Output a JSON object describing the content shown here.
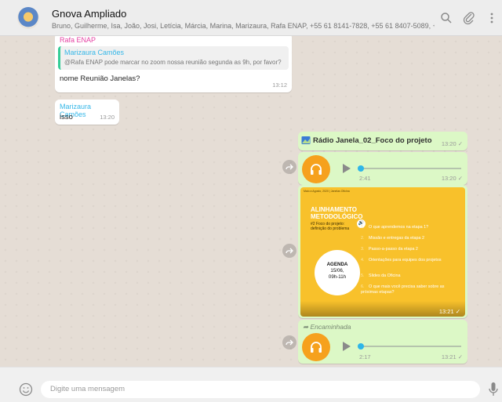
{
  "header": {
    "title": "Gnova Ampliado",
    "members": "Bruno, Guilherme, Isa, João, Josi, Letícia, Márcia, Marina, Marizaura, Rafa ENAP, +55 61 8141-7828, +55 61 8407-5089, +5"
  },
  "messages": {
    "m1": {
      "sender": "Rafa ENAP",
      "quote_sender": "Marizaura Camões",
      "quote_text": "@Rafa ENAP pode marcar no zoom nossa reunião segunda as 9h, por favor?",
      "text": "nome Reunião Janelas?",
      "time": "13:12"
    },
    "m2": {
      "sender": "Marizaura Camões",
      "text": "isso",
      "time": "13:20"
    },
    "doc": {
      "name": "Rádio Janela_02_Foco do projeto",
      "time": "13:20 ✓"
    },
    "audio1": {
      "duration": "2:41",
      "time": "13:20 ✓"
    },
    "image": {
      "time": "13:21 ✓",
      "header_small": "Maio a Agosto, 2020 | Janelas Oficina",
      "title": "ALINHAMENTO METODOLÓGICO",
      "subtitle": "#2 Foco do projeto: definição do problema",
      "agenda_title": "AGENDA",
      "agenda_date": "15/06,",
      "agenda_time": "09h-11h",
      "items": [
        {
          "n": "1.",
          "text": "O que aprendemos na etapa 1?"
        },
        {
          "n": "2.",
          "text": "Missão e entregas da etapa 2"
        },
        {
          "n": "3.",
          "text": "Passo-a-passo da etapa 2"
        },
        {
          "n": "4.",
          "text": "Orientações para equipes dos projetos"
        },
        {
          "n": "5.",
          "text": "Slides da Oficina"
        },
        {
          "n": "6.",
          "text": "O que mais você precisa saber sobre as próximas etapas?"
        }
      ]
    },
    "forwarded": {
      "label": "Encaminhada",
      "duration": "2:17",
      "time": "13:21 ✓"
    }
  },
  "audio_progress": {
    "audio1": 0.0,
    "audio2": 0.0
  },
  "compose": {
    "placeholder": "Digite uma mensagem"
  },
  "icons": [
    "search-icon",
    "attach-icon",
    "menu-icon",
    "emoji-icon",
    "mic-icon",
    "forward-icon",
    "headphones-icon",
    "play-icon",
    "document-icon"
  ],
  "colors": {
    "outgoing": "#dcf8c6",
    "incoming": "#ffffff",
    "accent_audio": "#f6a11d",
    "sender_pink": "#e542a3",
    "sender_blue": "#35b7e8"
  }
}
